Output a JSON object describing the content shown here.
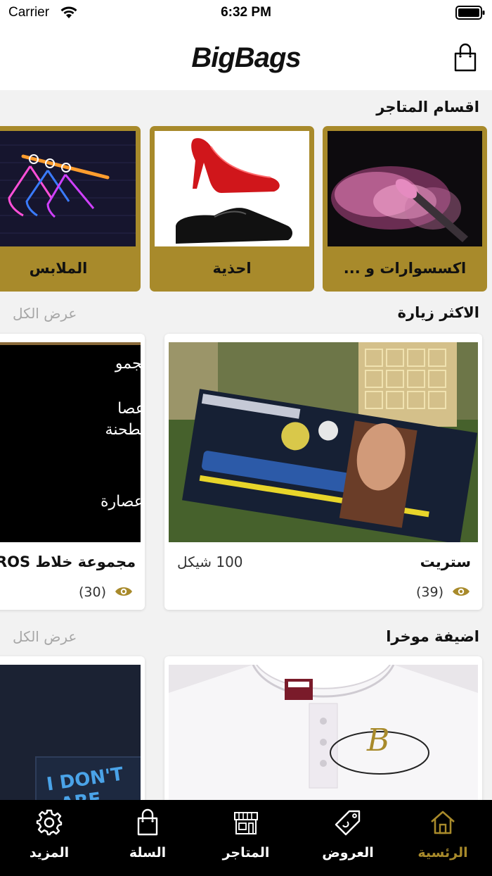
{
  "status_bar": {
    "carrier": "Carrier",
    "time": "6:32 PM"
  },
  "header": {
    "title": "BigBags"
  },
  "categories_section": {
    "title": "اقسام المتاجر",
    "items": [
      {
        "label": "اكسسوارات و ..."
      },
      {
        "label": "احذية"
      },
      {
        "label": "الملابس"
      }
    ]
  },
  "most_visited": {
    "title": "الاكثر زيارة",
    "see_all": "عرض الكل",
    "products": [
      {
        "name": "ستريت",
        "price": "100 شيكل",
        "views": "(39)"
      },
      {
        "name": "مجموعة خلاط  ROS",
        "views": "(30)",
        "image_text": [
          "مجمو",
          "عصا",
          "مطحنة",
          "عصارة"
        ]
      }
    ]
  },
  "recently_added": {
    "title": "اضيفة موخرا",
    "see_all": "عرض الكل",
    "products": [
      {
        "image_text": "B"
      },
      {
        "image_text": [
          "I DON'T",
          "ARE"
        ]
      }
    ]
  },
  "tab_bar": {
    "tabs": [
      {
        "label": "الرئسية",
        "icon": "home-icon"
      },
      {
        "label": "العروض",
        "icon": "tag-icon"
      },
      {
        "label": "المتاجر",
        "icon": "store-icon"
      },
      {
        "label": "السلة",
        "icon": "bag-icon"
      },
      {
        "label": "المزيد",
        "icon": "gear-icon"
      }
    ]
  },
  "colors": {
    "accent": "#a88a2b",
    "tabbar": "#000000",
    "background": "#f2f2f2"
  }
}
